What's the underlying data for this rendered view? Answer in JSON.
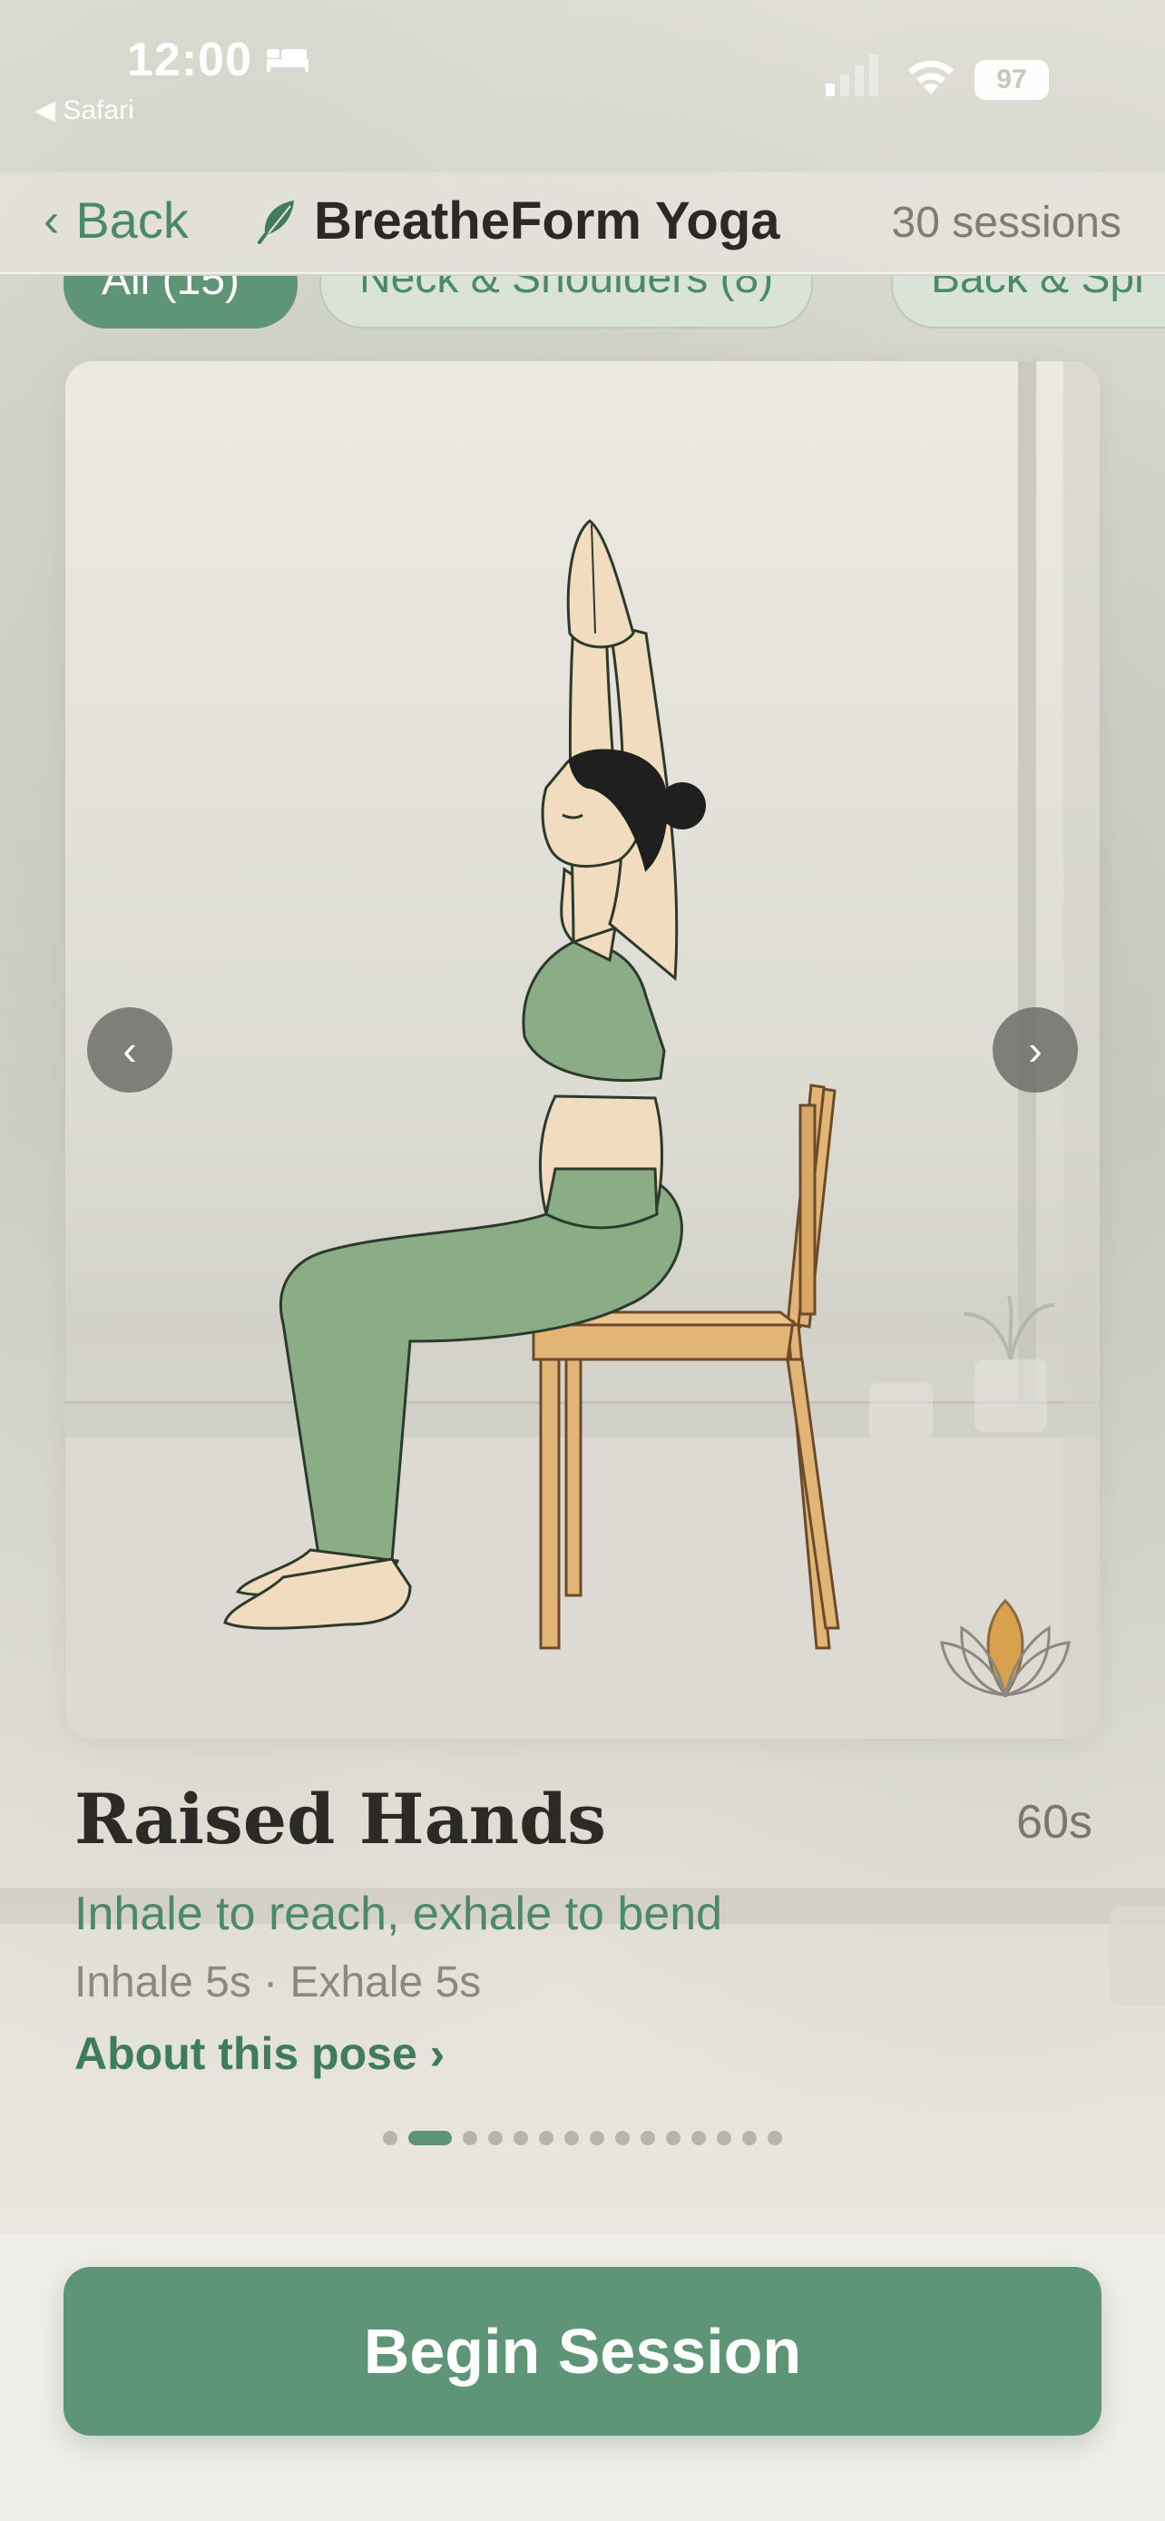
{
  "status_bar": {
    "time": "12:00",
    "back_app": "◀ Safari",
    "battery": "97"
  },
  "nav": {
    "back_label": "Back",
    "app_title": "BreatheForm Yoga",
    "sessions": "30 sessions"
  },
  "filters": [
    {
      "label": "All (15)",
      "active": true
    },
    {
      "label": "Neck & Shoulders (8)",
      "active": false
    },
    {
      "label": "Back & Spi",
      "active": false
    }
  ],
  "pose": {
    "name": "Raised Hands",
    "duration": "60s",
    "cue": "Inhale to reach, exhale to bend",
    "breath": "Inhale 5s · Exhale 5s",
    "about_link": "About this pose ›"
  },
  "carousel": {
    "total": 15,
    "current_index": 1
  },
  "primary_action": "Begin Session",
  "colors": {
    "accent": "#5f9577",
    "accent_text": "#4a8a66",
    "skin": "#f2dcbf",
    "outfit": "#8aad85",
    "chair": "#e2b577",
    "lotus": "#d9a04e"
  },
  "icons": {
    "back": "chevron-left-icon",
    "brand": "leaf-icon",
    "prev": "chevron-left-icon",
    "next": "chevron-right-icon",
    "lotus": "lotus-icon"
  }
}
